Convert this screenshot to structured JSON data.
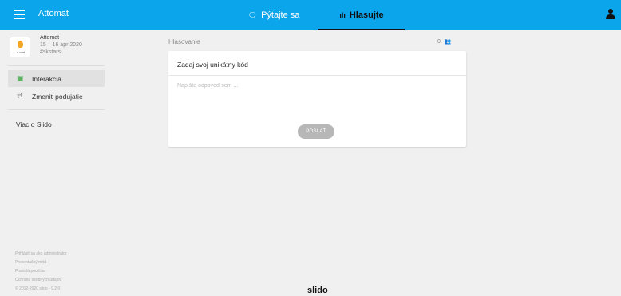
{
  "header": {
    "app_title": "Attomat",
    "tabs": [
      {
        "label": "Pýtajte sa",
        "icon": "speech-bubble-icon"
      },
      {
        "label": "Hlasujte",
        "icon": "bar-chart-icon"
      }
    ],
    "active_tab": "Hlasujte",
    "colors": {
      "bar": "#0ba5ec"
    }
  },
  "event": {
    "logo_text": "a-mat",
    "name": "Attomat",
    "dates": "15 – 16 apr 2020",
    "code": "#skstarsi"
  },
  "sidebar": {
    "items": [
      {
        "label": "Interakcia",
        "icon": "chat-icon",
        "active": true
      },
      {
        "label": "Zmeniť podujatie",
        "icon": "swap-icon",
        "active": false
      }
    ],
    "more_label": "Viac o Slido"
  },
  "footer": {
    "links": [
      "Prihlásiť sa ako administrátor ·",
      "Prezentačný mód",
      "Pravidlá použitia ·",
      "Ochrana osobných údajov",
      "© 2012-2020 slido - 9.2.0"
    ],
    "brand": "slido"
  },
  "main": {
    "section_label": "Hlasovanie",
    "participants": "0",
    "card": {
      "question": "Zadaj svoj unikátny kód",
      "placeholder": "Napíšte odpoveď sem ...",
      "submit_label": "POSLAŤ"
    }
  }
}
